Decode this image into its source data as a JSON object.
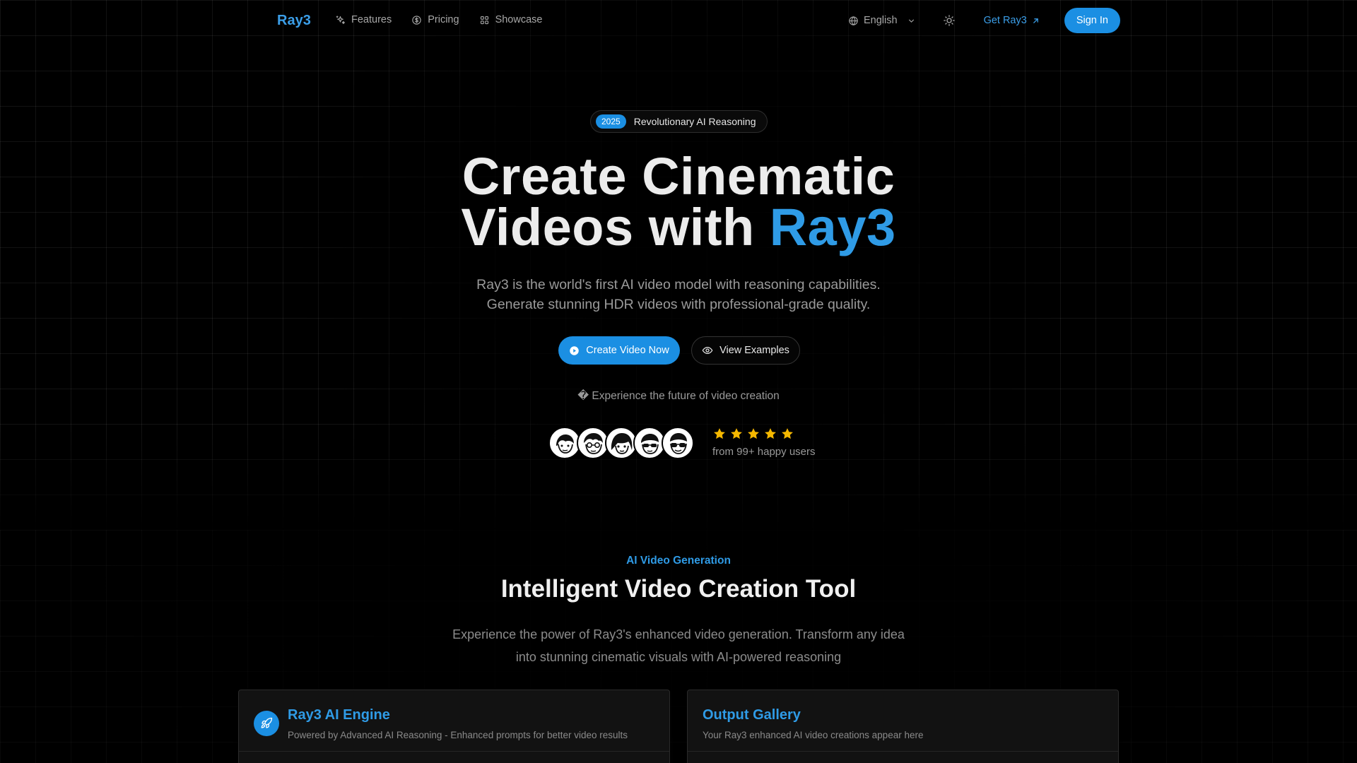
{
  "nav": {
    "logo": "Ray3",
    "links": [
      {
        "label": "Features",
        "icon": "sparkles-icon"
      },
      {
        "label": "Pricing",
        "icon": "dollar-circle-icon"
      },
      {
        "label": "Showcase",
        "icon": "grid-icon"
      }
    ],
    "language": "English",
    "get_label": "Get Ray3",
    "signin_label": "Sign In"
  },
  "hero": {
    "badge_year": "2025",
    "badge_text": "Revolutionary AI Reasoning",
    "title_line1": "Create Cinematic",
    "title_line2_prefix": "Videos with ",
    "title_accent": "Ray3",
    "subtitle_line1": "Ray3 is the world's first AI video model with reasoning capabilities.",
    "subtitle_line2": "Generate stunning HDR videos with professional-grade quality.",
    "primary_cta": "Create Video Now",
    "secondary_cta": "View Examples",
    "experience_text": "� Experience the future of video creation",
    "rating_stars": 5,
    "users_text": "from 99+ happy users"
  },
  "section": {
    "eyebrow": "AI Video Generation",
    "title": "Intelligent Video Creation Tool",
    "subtitle_line1": "Experience the power of Ray3's enhanced video generation. Transform any idea",
    "subtitle_line2": "into stunning cinematic visuals with AI-powered reasoning"
  },
  "cards": [
    {
      "title": "Ray3 AI Engine",
      "desc": "Powered by Advanced AI Reasoning - Enhanced prompts for better video results",
      "icon": "rocket-icon"
    },
    {
      "title": "Output Gallery",
      "desc": "Your Ray3 enhanced AI video creations appear here"
    }
  ],
  "colors": {
    "accent": "#1b8fe3",
    "accent_text": "#2f9be6",
    "background": "#000000",
    "star": "#f5b800"
  }
}
